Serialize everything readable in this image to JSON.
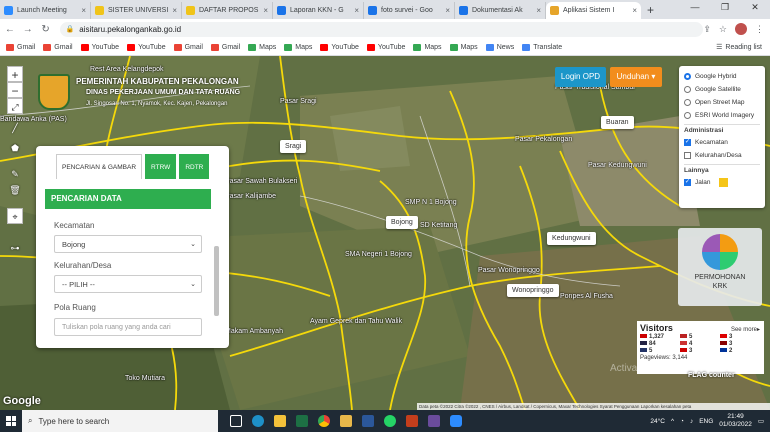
{
  "browser": {
    "tabs": [
      {
        "title": "Launch Meeting",
        "color": "#2d8cff"
      },
      {
        "title": "SISTER UNIVERSI",
        "color": "#f0c419"
      },
      {
        "title": "DAFTAR PROPOS",
        "color": "#f0c419"
      },
      {
        "title": "Laporan KKN - G",
        "color": "#1a73e8"
      },
      {
        "title": "foto survei - Goo",
        "color": "#1a73e8"
      },
      {
        "title": "Dokumentasi Ak",
        "color": "#1a73e8"
      },
      {
        "title": "Aplikasi Sistem I",
        "color": "#e6a52a"
      }
    ],
    "new_tab": "+",
    "url": "aisitaru.pekalongankab.go.id",
    "bookmarks": [
      {
        "label": "Gmail",
        "color": "#ea4335"
      },
      {
        "label": "Gmail",
        "color": "#ea4335"
      },
      {
        "label": "YouTube",
        "color": "#ff0000"
      },
      {
        "label": "YouTube",
        "color": "#ff0000"
      },
      {
        "label": "Gmail",
        "color": "#ea4335"
      },
      {
        "label": "Gmail",
        "color": "#ea4335"
      },
      {
        "label": "Maps",
        "color": "#34a853"
      },
      {
        "label": "Maps",
        "color": "#34a853"
      },
      {
        "label": "YouTube",
        "color": "#ff0000"
      },
      {
        "label": "YouTube",
        "color": "#ff0000"
      },
      {
        "label": "Maps",
        "color": "#34a853"
      },
      {
        "label": "Maps",
        "color": "#34a853"
      },
      {
        "label": "News",
        "color": "#4285f4"
      },
      {
        "label": "Translate",
        "color": "#4285f4"
      }
    ],
    "reading_list": "Reading list"
  },
  "header": {
    "line1": "PEMERINTAH KABUPATEN PEKALONGAN",
    "line2": "DINAS PEKERJAAN UMUM DAN TATA RUANG",
    "line3": "Jl. Singosari No. 1, Nyamok, Kec. Kajen, Pekalongan"
  },
  "buttons": {
    "login": "Login OPD",
    "unduhan": "Unduhan ▾"
  },
  "layers": {
    "base": [
      {
        "label": "Google Hybrid",
        "on": true
      },
      {
        "label": "Google Satellite",
        "on": false
      },
      {
        "label": "Open Street Map",
        "on": false
      },
      {
        "label": "ESRI World Imagery",
        "on": false
      }
    ],
    "admin_head": "Administrasi",
    "admin": [
      {
        "label": "Kecamatan",
        "on": true
      },
      {
        "label": "Kelurahan/Desa",
        "on": false
      }
    ],
    "other_head": "Lainnya",
    "jalan": "Jalan",
    "jalan_color": "#f5c518"
  },
  "panel": {
    "tabs": [
      "PENCARIAN & GAMBAR",
      "RTRW",
      "RDTR"
    ],
    "title": "PENCARIAN DATA",
    "kecamatan_label": "Kecamatan",
    "kecamatan_value": "Bojong",
    "kelurahan_label": "Kelurahan/Desa",
    "kelurahan_value": "-- PILIH --",
    "pola_label": "Pola Ruang",
    "pola_placeholder": "Tuliskan pola ruang yang anda cari"
  },
  "permohonan": {
    "line1": "PERMOHONAN",
    "line2": "KRK"
  },
  "visitors": {
    "title": "Visitors",
    "more": "See more▸",
    "counts": [
      "1,327",
      "5",
      "3",
      "84",
      "4",
      "3",
      "5",
      "3",
      "2"
    ],
    "pageviews": "Pageviews: 3,144",
    "flag": "FLAG counter"
  },
  "map": {
    "callouts": [
      "Buaran",
      "Sragi",
      "Bojong",
      "Kedungwuni",
      "Wonopringgo"
    ],
    "labels": [
      "Rest Area Kelangdepok",
      "Pasar Sragi",
      "Bandawa Anka (PAS)",
      "Pasar Sawah Bulakseri",
      "Pasar Kalijambe",
      "SMA Negeri 1 Bojong",
      "SD Ketitang",
      "Pasar Wonopringgo",
      "Pasar Tradisional Sambal",
      "Ponpes Al Fusha",
      "Ayam Geprek dan Tahu Walik",
      "Toko Mutiara",
      "Pasar Pekalongan",
      "Makam Ambanyah",
      "SMP N 1 Bojong",
      "Pasar Kedungwuni"
    ],
    "google": "Google",
    "attribution": "Data peta ©2022 Citra ©2022 , CNES / Airbus, Landsat / Copernicus, Maxar Technologies   Syarat Penggunaan   Laporkan kesalahan peta",
    "watermark": "Activate Windows"
  },
  "taskbar": {
    "search": "Type here to search",
    "time": "21:49",
    "date": "01/03/2022",
    "lang": "ENG",
    "weather": "24°C"
  }
}
